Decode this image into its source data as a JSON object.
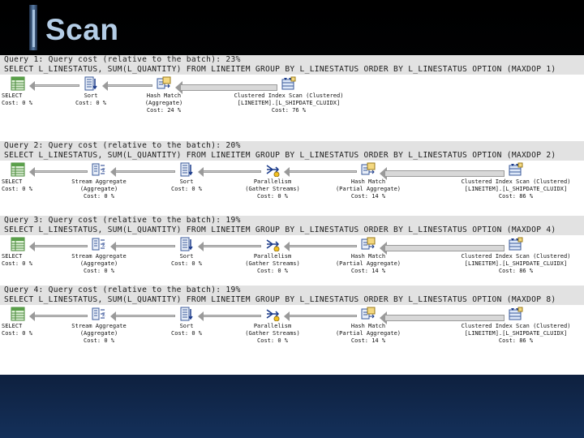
{
  "title": "Scan",
  "queries": [
    {
      "header": "Query 1: Query cost (relative to the batch): 23%",
      "sql": "SELECT L_LINESTATUS, SUM(L_QUANTITY) FROM LINEITEM GROUP BY L_LINESTATUS ORDER BY L_LINESTATUS OPTION (MAXDOP 1)",
      "ops": [
        {
          "name": "SELECT",
          "sub": "",
          "cost": "Cost: 0 %",
          "icon": "select"
        },
        {
          "name": "Sort",
          "sub": "",
          "cost": "Cost: 0 %",
          "icon": "sort"
        },
        {
          "name": "Hash Match",
          "sub": "(Aggregate)",
          "cost": "Cost: 24 %",
          "icon": "hash"
        },
        {
          "name": "Clustered Index Scan (Clustered)",
          "sub": "[LINEITEM].[L_SHIPDATE_CLUIDX]",
          "cost": "Cost: 76 %",
          "icon": "scan"
        }
      ]
    },
    {
      "header": "Query 2: Query cost (relative to the batch): 20%",
      "sql": "SELECT L_LINESTATUS, SUM(L_QUANTITY) FROM LINEITEM GROUP BY L_LINESTATUS ORDER BY L_LINESTATUS OPTION (MAXDOP 2)",
      "ops": [
        {
          "name": "SELECT",
          "sub": "",
          "cost": "Cost: 0 %",
          "icon": "select"
        },
        {
          "name": "Stream Aggregate",
          "sub": "(Aggregate)",
          "cost": "Cost: 0 %",
          "icon": "stream"
        },
        {
          "name": "Sort",
          "sub": "",
          "cost": "Cost: 0 %",
          "icon": "sort"
        },
        {
          "name": "Parallelism",
          "sub": "(Gather Streams)",
          "cost": "Cost: 0 %",
          "icon": "parallel"
        },
        {
          "name": "Hash Match",
          "sub": "(Partial Aggregate)",
          "cost": "Cost: 14 %",
          "icon": "hash"
        },
        {
          "name": "Clustered Index Scan (Clustered)",
          "sub": "[LINEITEM].[L_SHIPDATE_CLUIDX]",
          "cost": "Cost: 86 %",
          "icon": "scan"
        }
      ]
    },
    {
      "header": "Query 3: Query cost (relative to the batch): 19%",
      "sql": "SELECT L_LINESTATUS, SUM(L_QUANTITY) FROM LINEITEM GROUP BY L_LINESTATUS ORDER BY L_LINESTATUS OPTION (MAXDOP 4)",
      "ops": [
        {
          "name": "SELECT",
          "sub": "",
          "cost": "Cost: 0 %",
          "icon": "select"
        },
        {
          "name": "Stream Aggregate",
          "sub": "(Aggregate)",
          "cost": "Cost: 0 %",
          "icon": "stream"
        },
        {
          "name": "Sort",
          "sub": "",
          "cost": "Cost: 0 %",
          "icon": "sort"
        },
        {
          "name": "Parallelism",
          "sub": "(Gather Streams)",
          "cost": "Cost: 0 %",
          "icon": "parallel"
        },
        {
          "name": "Hash Match",
          "sub": "(Partial Aggregate)",
          "cost": "Cost: 14 %",
          "icon": "hash"
        },
        {
          "name": "Clustered Index Scan (Clustered)",
          "sub": "[LINEITEM].[L_SHIPDATE_CLUIDX]",
          "cost": "Cost: 86 %",
          "icon": "scan"
        }
      ]
    },
    {
      "header": "Query 4: Query cost (relative to the batch): 19%",
      "sql": "SELECT L_LINESTATUS, SUM(L_QUANTITY) FROM LINEITEM GROUP BY L_LINESTATUS ORDER BY L_LINESTATUS OPTION (MAXDOP 8)",
      "ops": [
        {
          "name": "SELECT",
          "sub": "",
          "cost": "Cost: 0 %",
          "icon": "select"
        },
        {
          "name": "Stream Aggregate",
          "sub": "(Aggregate)",
          "cost": "Cost: 0 %",
          "icon": "stream"
        },
        {
          "name": "Sort",
          "sub": "",
          "cost": "Cost: 0 %",
          "icon": "sort"
        },
        {
          "name": "Parallelism",
          "sub": "(Gather Streams)",
          "cost": "Cost: 0 %",
          "icon": "parallel"
        },
        {
          "name": "Hash Match",
          "sub": "(Partial Aggregate)",
          "cost": "Cost: 14 %",
          "icon": "hash"
        },
        {
          "name": "Clustered Index Scan (Clustered)",
          "sub": "[LINEITEM].[L_SHIPDATE_CLUIDX]",
          "cost": "Cost: 86 %",
          "icon": "scan"
        }
      ]
    }
  ]
}
